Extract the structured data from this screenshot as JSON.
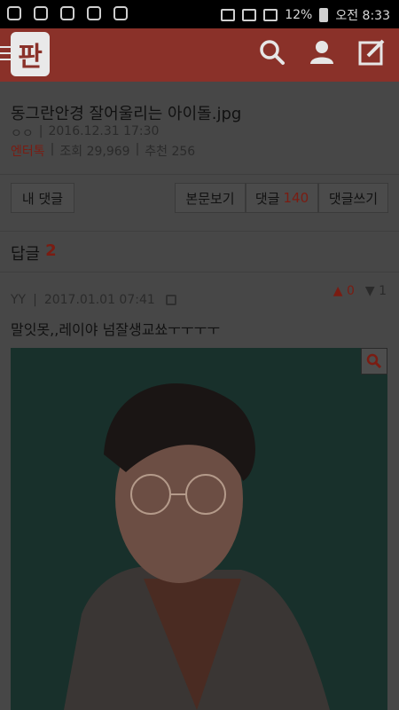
{
  "statusbar": {
    "battery": "12%",
    "time": "오전 8:33"
  },
  "header": {
    "logo": "판"
  },
  "post": {
    "title": "동그란안경 잘어울리는 아이돌.jpg",
    "author": "ㅇㅇ",
    "date": "2016.12.31 17:30",
    "category": "엔터톡",
    "views": "조회 29,969",
    "recommend": "추천 256"
  },
  "actions": {
    "my_comments": "내 댓글",
    "view_body": "본문보기",
    "comments_label": "댓글",
    "comments_count": "140",
    "write_comment": "댓글쓰기"
  },
  "replies": {
    "label": "답글",
    "count": "2"
  },
  "comment": {
    "author": "YY",
    "date": "2017.01.01 07:41",
    "up": "0",
    "down": "1",
    "text": "말잇못,,레이야 넘잘생교쑈ㅜㅜㅜㅜ"
  },
  "colors": {
    "header": "#8a3129",
    "accent": "#7a1c12"
  }
}
